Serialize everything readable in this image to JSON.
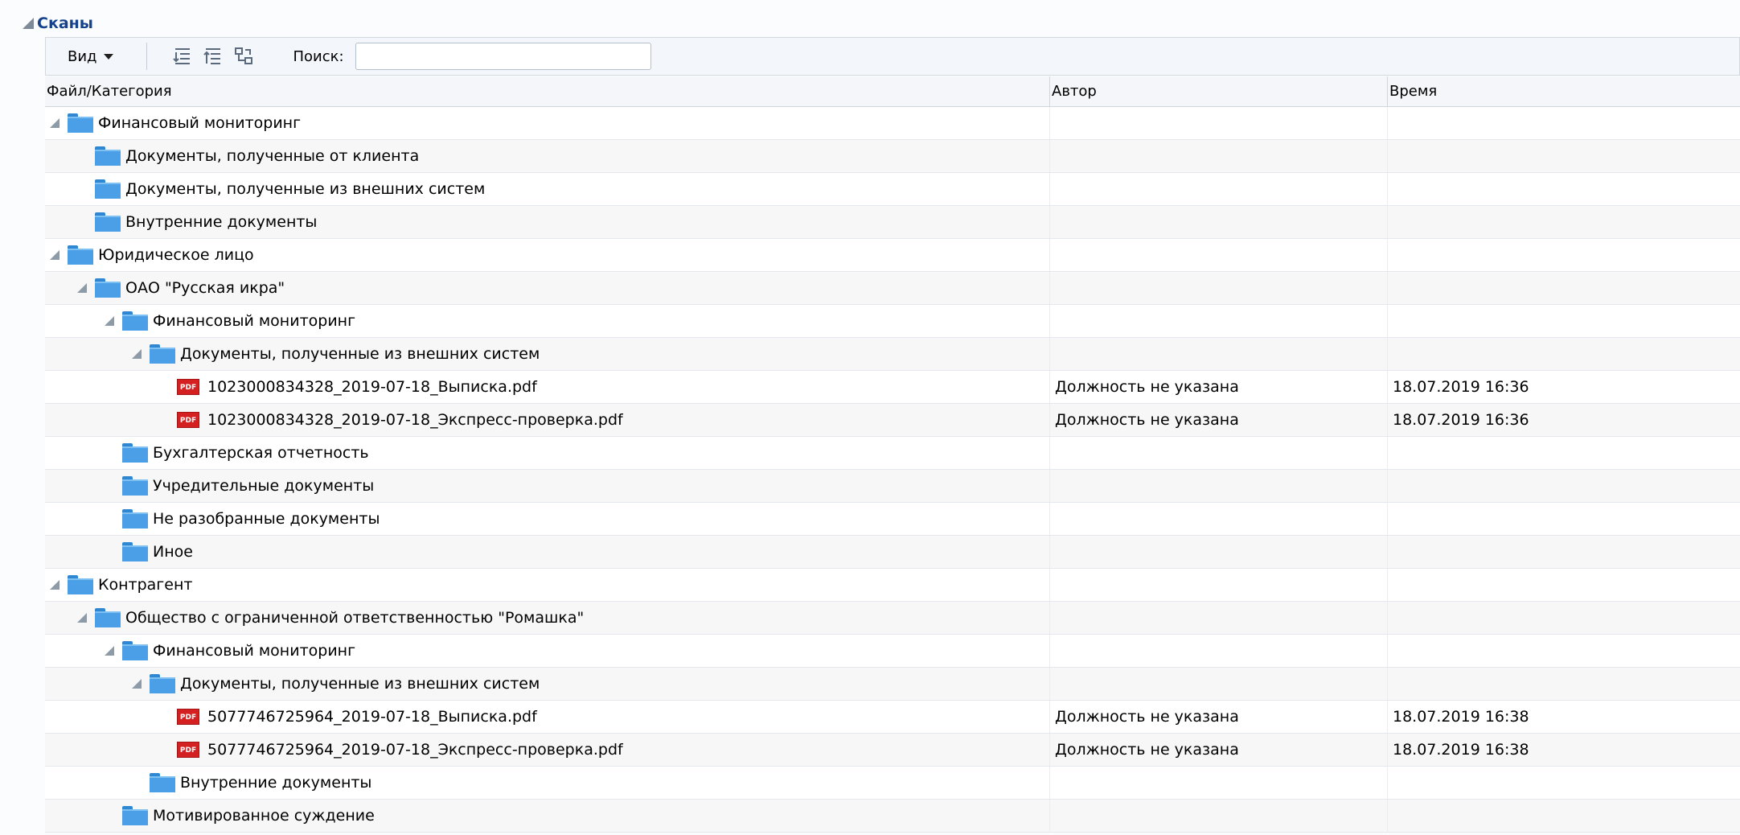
{
  "panel": {
    "title": "Сканы"
  },
  "toolbar": {
    "view_label": "Вид",
    "search_label": "Поиск:",
    "search_value": "",
    "icons": [
      "expand-all-icon",
      "collapse-all-icon",
      "tree-refresh-icon"
    ]
  },
  "grid": {
    "columns": [
      "Файл/Категория",
      "Автор",
      "Время"
    ],
    "rows": [
      {
        "level": 0,
        "type": "folder",
        "expanded": true,
        "name": "Финансовый мониторинг",
        "author": "",
        "time": ""
      },
      {
        "level": 1,
        "type": "folder",
        "expanded": false,
        "name": "Документы, полученные от клиента",
        "author": "",
        "time": ""
      },
      {
        "level": 1,
        "type": "folder",
        "expanded": false,
        "name": "Документы, полученные из внешних систем",
        "author": "",
        "time": ""
      },
      {
        "level": 1,
        "type": "folder",
        "expanded": false,
        "name": "Внутренние документы",
        "author": "",
        "time": ""
      },
      {
        "level": 0,
        "type": "folder",
        "expanded": true,
        "name": "Юридическое лицо",
        "author": "",
        "time": ""
      },
      {
        "level": 1,
        "type": "folder",
        "expanded": true,
        "name": "ОАО \"Русская икра\"",
        "author": "",
        "time": ""
      },
      {
        "level": 2,
        "type": "folder",
        "expanded": true,
        "name": "Финансовый мониторинг",
        "author": "",
        "time": ""
      },
      {
        "level": 3,
        "type": "folder",
        "expanded": true,
        "name": "Документы, полученные из внешних систем",
        "author": "",
        "time": ""
      },
      {
        "level": 4,
        "type": "pdf",
        "expanded": false,
        "name": "1023000834328_2019-07-18_Выписка.pdf",
        "author": "Должность не указана",
        "time": "18.07.2019 16:36"
      },
      {
        "level": 4,
        "type": "pdf",
        "expanded": false,
        "name": "1023000834328_2019-07-18_Экспресс-проверка.pdf",
        "author": "Должность не указана",
        "time": "18.07.2019 16:36"
      },
      {
        "level": 2,
        "type": "folder",
        "expanded": false,
        "name": "Бухгалтерская отчетность",
        "author": "",
        "time": ""
      },
      {
        "level": 2,
        "type": "folder",
        "expanded": false,
        "name": "Учредительные документы",
        "author": "",
        "time": ""
      },
      {
        "level": 2,
        "type": "folder",
        "expanded": false,
        "name": "Не разобранные документы",
        "author": "",
        "time": ""
      },
      {
        "level": 2,
        "type": "folder",
        "expanded": false,
        "name": "Иное",
        "author": "",
        "time": ""
      },
      {
        "level": 0,
        "type": "folder",
        "expanded": true,
        "name": "Контрагент",
        "author": "",
        "time": ""
      },
      {
        "level": 1,
        "type": "folder",
        "expanded": true,
        "name": "Общество с ограниченной ответственностью \"Ромашка\"",
        "author": "",
        "time": ""
      },
      {
        "level": 2,
        "type": "folder",
        "expanded": true,
        "name": "Финансовый мониторинг",
        "author": "",
        "time": ""
      },
      {
        "level": 3,
        "type": "folder",
        "expanded": true,
        "name": "Документы, полученные из внешних систем",
        "author": "",
        "time": ""
      },
      {
        "level": 4,
        "type": "pdf",
        "expanded": false,
        "name": "5077746725964_2019-07-18_Выписка.pdf",
        "author": "Должность не указана",
        "time": "18.07.2019 16:38"
      },
      {
        "level": 4,
        "type": "pdf",
        "expanded": false,
        "name": "5077746725964_2019-07-18_Экспресс-проверка.pdf",
        "author": "Должность не указана",
        "time": "18.07.2019 16:38"
      },
      {
        "level": 3,
        "type": "folder",
        "expanded": false,
        "name": "Внутренние документы",
        "author": "",
        "time": ""
      },
      {
        "level": 2,
        "type": "folder",
        "expanded": false,
        "name": "Мотивированное суждение",
        "author": "",
        "time": ""
      }
    ]
  },
  "colors": {
    "title": "#15428b",
    "folder": "#4a9fe6",
    "pdf": "#d42020"
  }
}
